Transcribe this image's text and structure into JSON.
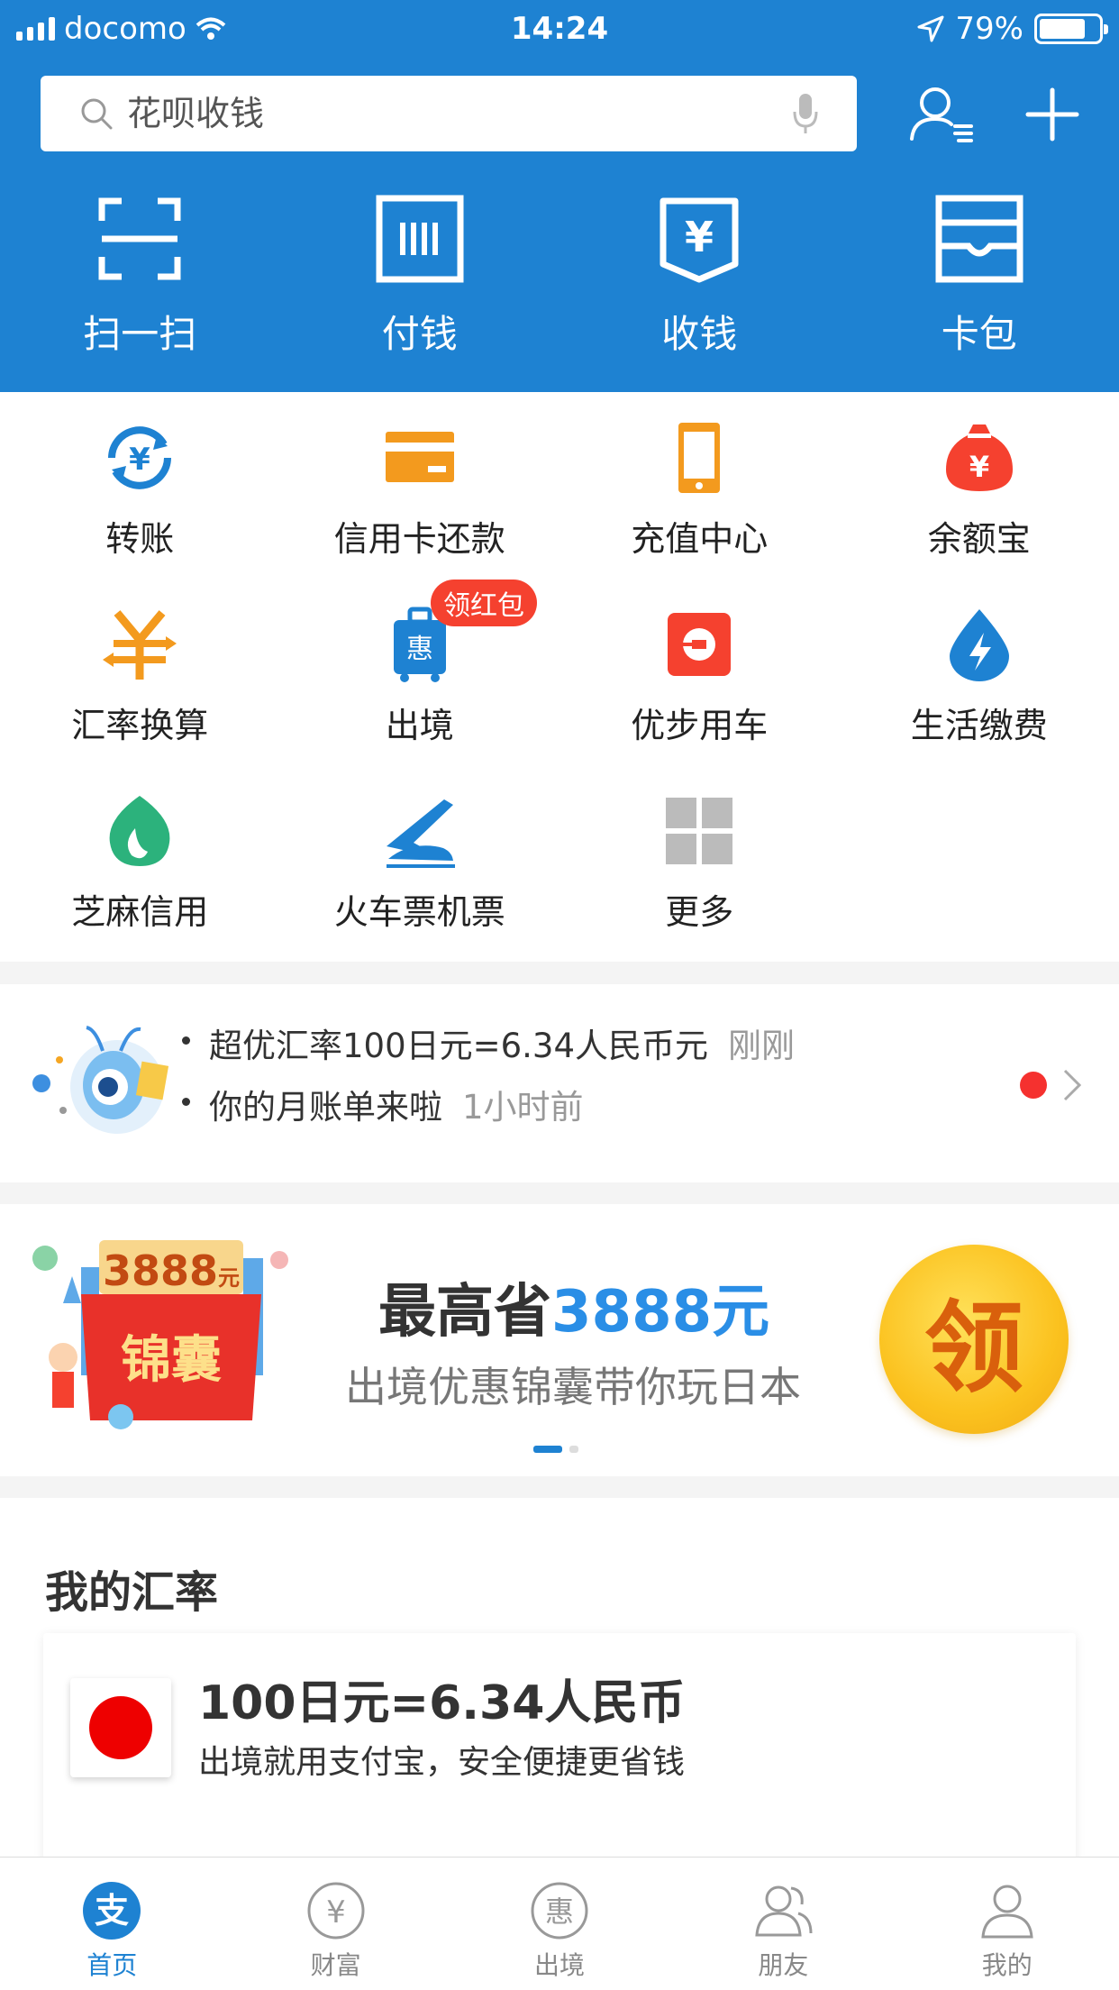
{
  "status_bar": {
    "carrier": "docomo",
    "time": "14:24",
    "battery": "79%"
  },
  "search": {
    "placeholder": "花呗收钱"
  },
  "top_nav": [
    {
      "label": "扫一扫",
      "icon": "scan-icon"
    },
    {
      "label": "付钱",
      "icon": "barcode-pay-icon"
    },
    {
      "label": "收钱",
      "icon": "yuan-receive-icon"
    },
    {
      "label": "卡包",
      "icon": "card-wallet-icon"
    }
  ],
  "services": [
    {
      "label": "转账",
      "icon": "transfer-icon",
      "color": "#1e82d2"
    },
    {
      "label": "信用卡还款",
      "icon": "credit-card-icon",
      "color": "#f39a1e"
    },
    {
      "label": "充值中心",
      "icon": "phone-recharge-icon",
      "color": "#f39a1e"
    },
    {
      "label": "余额宝",
      "icon": "money-bag-icon",
      "color": "#f5412f"
    },
    {
      "label": "汇率换算",
      "icon": "exchange-rate-icon",
      "color": "#f39a1e"
    },
    {
      "label": "出境",
      "icon": "luggage-icon",
      "color": "#1e82d2",
      "badge": "领红包"
    },
    {
      "label": "优步用车",
      "icon": "uber-icon",
      "color": "#f5412f"
    },
    {
      "label": "生活缴费",
      "icon": "utility-drop-icon",
      "color": "#1e82d2"
    },
    {
      "label": "芝麻信用",
      "icon": "sesame-credit-icon",
      "color": "#2cb27c"
    },
    {
      "label": "火车票机票",
      "icon": "train-plane-icon",
      "color": "#1e82d2"
    },
    {
      "label": "更多",
      "icon": "more-grid-icon",
      "color": "#bbbbbb"
    }
  ],
  "notices": [
    {
      "text": "超优汇率100日元=6.34人民币元",
      "time": "刚刚"
    },
    {
      "text": "你的月账单来啦",
      "time": "1小时前"
    }
  ],
  "banner": {
    "title_prefix": "最高省",
    "title_highlight": "3888元",
    "subtitle": "出境优惠锦囊带你玩日本",
    "coin_text": "领",
    "promo_amount": "3888",
    "promo_unit": "元",
    "promo_word": "锦囊"
  },
  "rate_section": {
    "heading": "我的汇率",
    "rate": "100日元=6.34人民币",
    "slogan": "出境就用支付宝，安全便捷更省钱"
  },
  "tabs": [
    {
      "label": "首页",
      "icon": "alipay-home-icon",
      "active": true
    },
    {
      "label": "财富",
      "icon": "wealth-icon",
      "active": false
    },
    {
      "label": "出境",
      "icon": "overseas-icon",
      "active": false
    },
    {
      "label": "朋友",
      "icon": "friends-icon",
      "active": false
    },
    {
      "label": "我的",
      "icon": "profile-icon",
      "active": false
    }
  ],
  "colors": {
    "brand_blue": "#1e82d2",
    "accent_red": "#f5412f",
    "orange": "#f39a1e",
    "green": "#2cb27c"
  }
}
